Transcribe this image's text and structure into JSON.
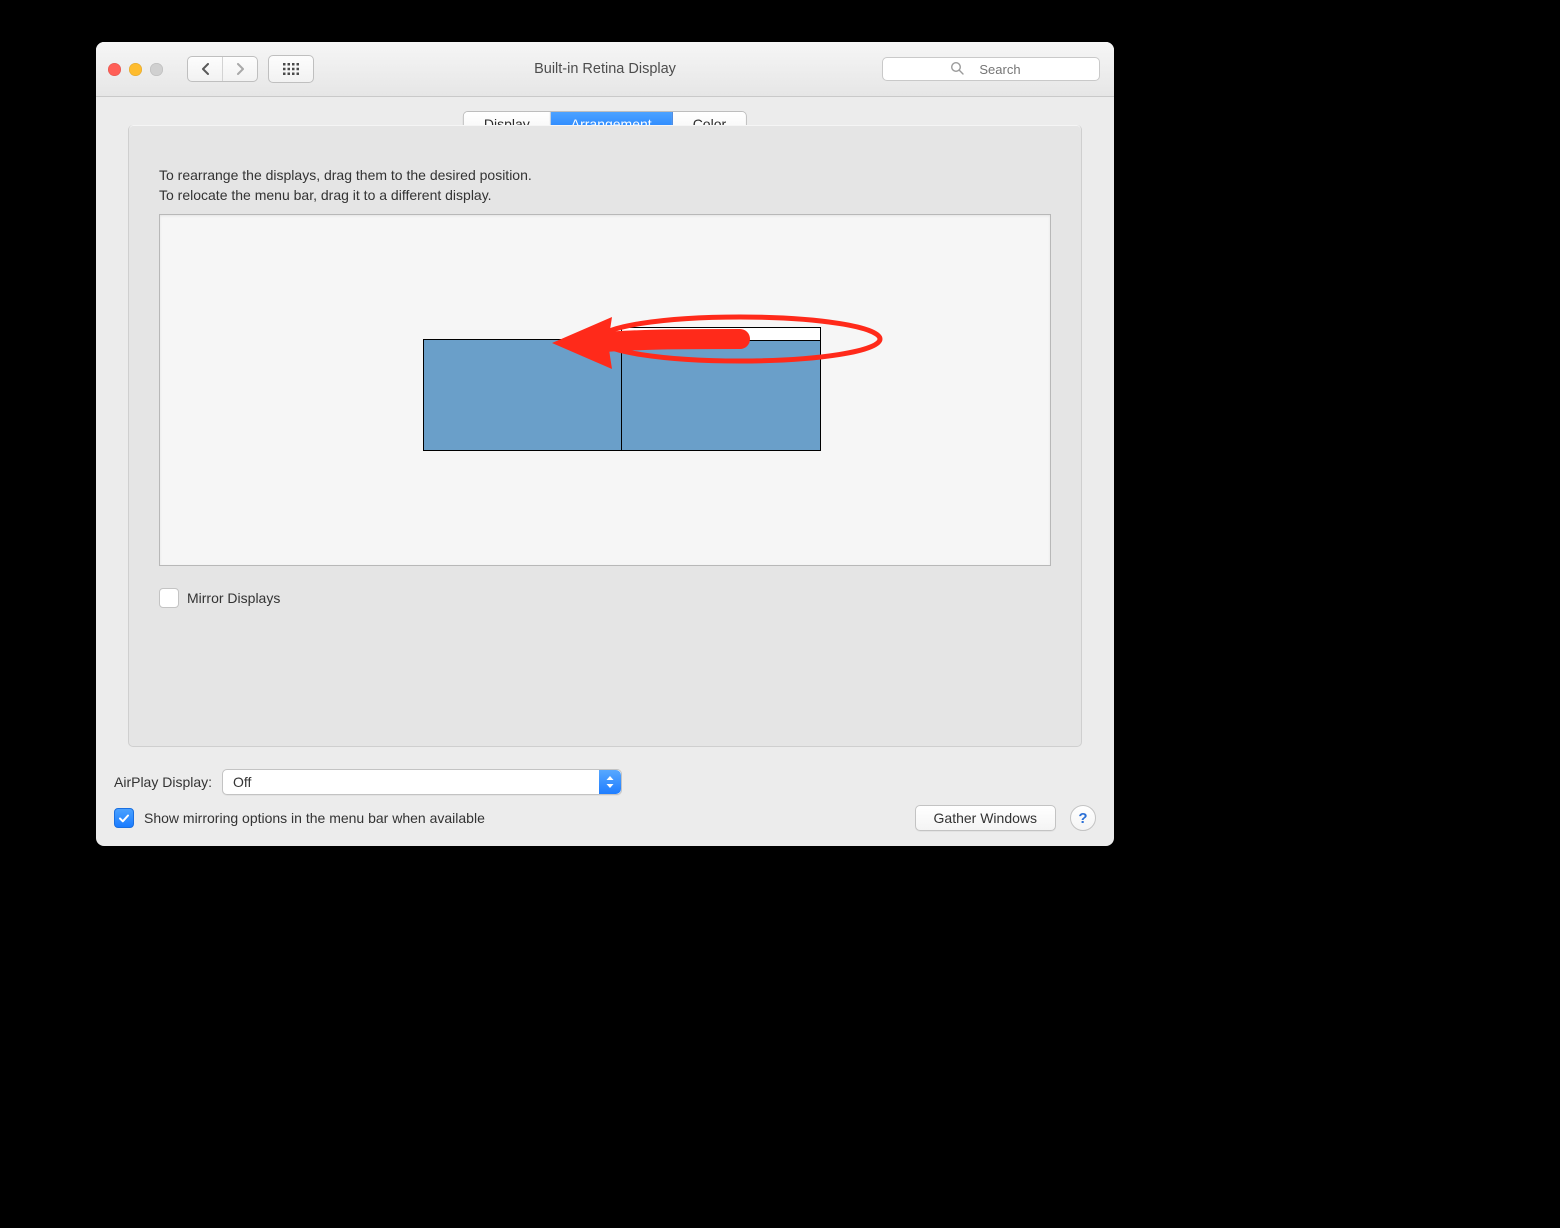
{
  "window": {
    "title": "Built-in Retina Display"
  },
  "toolbar": {
    "search_placeholder": "Search"
  },
  "tabs": {
    "display": "Display",
    "arrangement": "Arrangement",
    "color": "Color",
    "active": "arrangement"
  },
  "panel": {
    "instruction_line1": "To rearrange the displays, drag them to the desired position.",
    "instruction_line2": "To relocate the menu bar, drag it to a different display.",
    "mirror_label": "Mirror Displays",
    "mirror_checked": false
  },
  "airplay": {
    "label": "AirPlay Display:",
    "value": "Off"
  },
  "mirroring": {
    "checked": true,
    "label": "Show mirroring options in the menu bar when available"
  },
  "buttons": {
    "gather": "Gather Windows",
    "help": "?"
  }
}
